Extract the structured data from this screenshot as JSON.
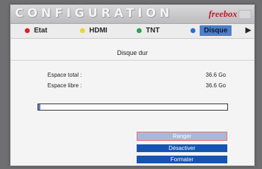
{
  "window": {
    "title": "CONFIGURATION",
    "brand": "freebox"
  },
  "tabs": [
    {
      "label": "Etat",
      "dot_color": "#d8232a"
    },
    {
      "label": "HDMI",
      "dot_color": "#f2d22a"
    },
    {
      "label": "TNT",
      "dot_color": "#2aa34a"
    },
    {
      "label": "Disque",
      "dot_color": "#2a6fd0",
      "active": true
    }
  ],
  "tabs_next_icon": "chevron-right-icon",
  "section": {
    "title": "Disque dur"
  },
  "disk": {
    "total_label": "Espace total :",
    "total_value": "36.6 Go",
    "free_label": "Espace libre :",
    "free_value": "36.6 Go",
    "used_fraction": 0.01
  },
  "buttons": {
    "eject": "Ranger",
    "activate": "Désactiver",
    "format": "Formater"
  },
  "colors": {
    "accent": "#1554b2",
    "brand": "#c4182a"
  }
}
